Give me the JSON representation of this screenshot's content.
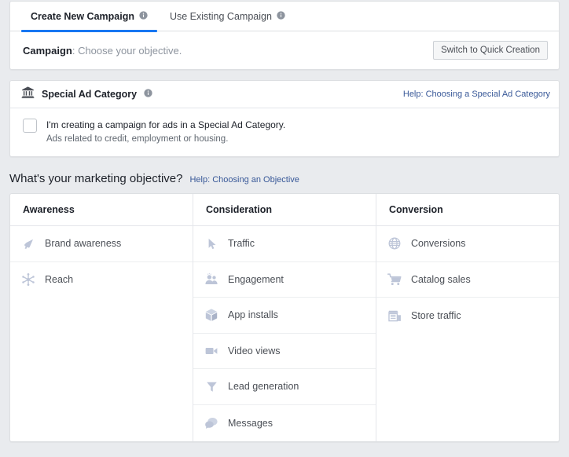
{
  "tabs": [
    {
      "label": "Create New Campaign",
      "icon": "info-icon",
      "active": true
    },
    {
      "label": "Use Existing Campaign",
      "icon": "info-icon",
      "active": false
    }
  ],
  "campaign_row": {
    "label_bold": "Campaign",
    "label_rest": ": Choose your objective.",
    "button_label": "Switch to Quick Creation"
  },
  "special_ad_category": {
    "icon": "bank-building-icon",
    "title": "Special Ad Category",
    "info_icon": "info-icon",
    "help_link": "Help: Choosing a Special Ad Category",
    "checkbox_checked": false,
    "checkbox_label": "I'm creating a campaign for ads in a Special Ad Category.",
    "checkbox_sublabel": "Ads related to credit, employment or housing."
  },
  "objective_section": {
    "heading": "What's your marketing objective?",
    "help_link": "Help: Choosing an Objective",
    "columns": [
      {
        "header": "Awareness",
        "items": [
          {
            "label": "Brand awareness",
            "icon": "megaphone-icon"
          },
          {
            "label": "Reach",
            "icon": "network-burst-icon"
          }
        ]
      },
      {
        "header": "Consideration",
        "items": [
          {
            "label": "Traffic",
            "icon": "cursor-arrow-icon"
          },
          {
            "label": "Engagement",
            "icon": "people-icon"
          },
          {
            "label": "App installs",
            "icon": "cube-box-icon"
          },
          {
            "label": "Video views",
            "icon": "video-camera-icon"
          },
          {
            "label": "Lead generation",
            "icon": "funnel-icon"
          },
          {
            "label": "Messages",
            "icon": "speech-bubbles-icon"
          }
        ]
      },
      {
        "header": "Conversion",
        "items": [
          {
            "label": "Conversions",
            "icon": "globe-icon"
          },
          {
            "label": "Catalog sales",
            "icon": "shopping-cart-icon"
          },
          {
            "label": "Store traffic",
            "icon": "storefront-icon"
          }
        ]
      }
    ]
  },
  "colors": {
    "accent": "#1877f2",
    "link": "#385898",
    "page_bg": "#e9ebee",
    "icon": "#bdc5d8",
    "text_primary": "#1d2129",
    "text_secondary": "#606770"
  }
}
